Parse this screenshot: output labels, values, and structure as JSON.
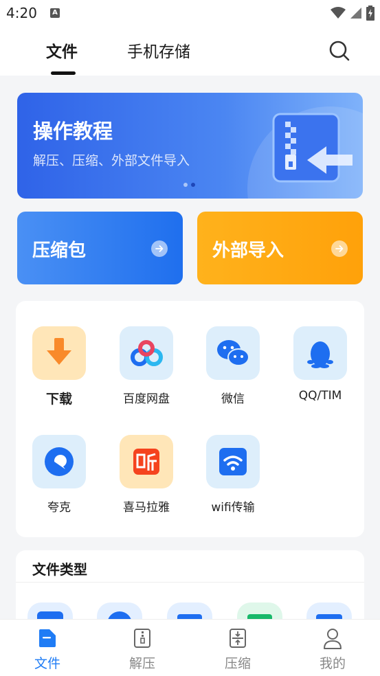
{
  "status_bar": {
    "time": "4:20",
    "notification_glyph": "A"
  },
  "header": {
    "tabs": [
      {
        "label": "文件",
        "active": true
      },
      {
        "label": "手机存储",
        "active": false
      }
    ],
    "search_icon": "search-icon"
  },
  "banner": {
    "title": "操作教程",
    "subtitle": "解压、压缩、外部文件导入",
    "slides": 2,
    "active_slide": 2
  },
  "quick_cards": [
    {
      "label": "压缩包",
      "color": "#2a7af0"
    },
    {
      "label": "外部导入",
      "color": "#ffaa12"
    }
  ],
  "apps": [
    {
      "label": "下载",
      "icon": "download-icon"
    },
    {
      "label": "百度网盘",
      "icon": "baidu-netdisk-icon"
    },
    {
      "label": "微信",
      "icon": "wechat-icon"
    },
    {
      "label": "QQ/TIM",
      "icon": "qq-icon"
    },
    {
      "label": "夸克",
      "icon": "quark-icon"
    },
    {
      "label": "喜马拉雅",
      "icon": "ximalaya-icon"
    },
    {
      "label": "wifi传输",
      "icon": "wifi-transfer-icon"
    }
  ],
  "file_types": {
    "title": "文件类型"
  },
  "bottom_nav": [
    {
      "label": "文件",
      "active": true,
      "icon": "file-icon"
    },
    {
      "label": "解压",
      "active": false,
      "icon": "extract-icon"
    },
    {
      "label": "压缩",
      "active": false,
      "icon": "compress-icon"
    },
    {
      "label": "我的",
      "active": false,
      "icon": "profile-icon"
    }
  ],
  "colors": {
    "accent": "#1f7cf5",
    "banner": "#3a6ff0",
    "import": "#ffaa12"
  }
}
